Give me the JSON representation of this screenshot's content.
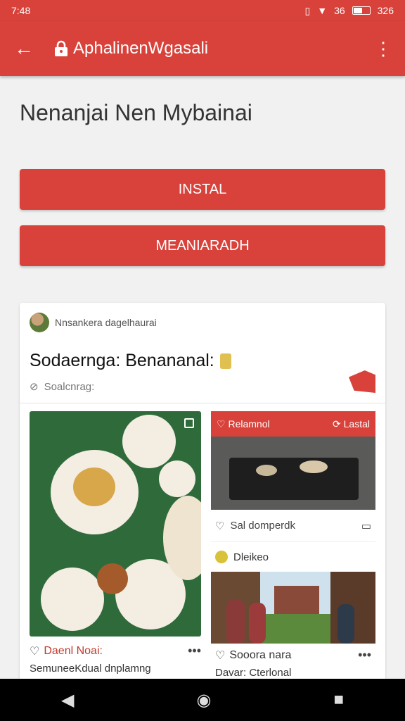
{
  "status": {
    "time": "7:48",
    "signal": "36",
    "battery": "326"
  },
  "appbar": {
    "title": "AphalinenWgasali"
  },
  "page": {
    "heading": "Nenanjai Nen Mybainai"
  },
  "buttons": {
    "install": "INSTAL",
    "secondary": "MEANIARADH"
  },
  "card": {
    "author": "Nnsankera dagelhaurai",
    "title": "Sodaernga: Benananal:",
    "meta": "Soalcnrag:",
    "food": {
      "name": "Daenl Noai:",
      "desc": "SemuneeKdual dnplamng"
    },
    "right": {
      "header_left": "Relamnol",
      "header_right": "Lastal",
      "likes": "Sal domperdk",
      "label": "Dleikeo",
      "name": "Sooora nara",
      "desc": "Davar: Cterlonal"
    }
  },
  "colors": {
    "primary": "#d8423b",
    "secondary": "#e0c050"
  }
}
